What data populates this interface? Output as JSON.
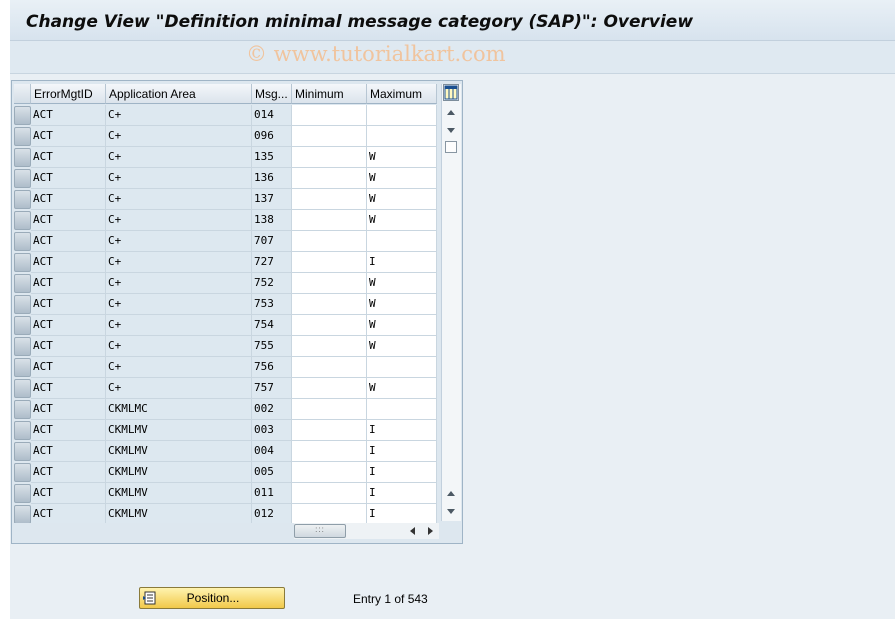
{
  "title": "Change View \"Definition minimal message category (SAP)\": Overview",
  "watermark": "© www.tutorialkart.com",
  "table": {
    "columns": [
      "ErrorMgtID",
      "Application Area",
      "Msg...",
      "Minimum",
      "Maximum"
    ],
    "rows": [
      [
        "ACT",
        "C+",
        "014",
        "",
        ""
      ],
      [
        "ACT",
        "C+",
        "096",
        "",
        ""
      ],
      [
        "ACT",
        "C+",
        "135",
        "",
        "W"
      ],
      [
        "ACT",
        "C+",
        "136",
        "",
        "W"
      ],
      [
        "ACT",
        "C+",
        "137",
        "",
        "W"
      ],
      [
        "ACT",
        "C+",
        "138",
        "",
        "W"
      ],
      [
        "ACT",
        "C+",
        "707",
        "",
        ""
      ],
      [
        "ACT",
        "C+",
        "727",
        "",
        "I"
      ],
      [
        "ACT",
        "C+",
        "752",
        "",
        "W"
      ],
      [
        "ACT",
        "C+",
        "753",
        "",
        "W"
      ],
      [
        "ACT",
        "C+",
        "754",
        "",
        "W"
      ],
      [
        "ACT",
        "C+",
        "755",
        "",
        "W"
      ],
      [
        "ACT",
        "C+",
        "756",
        "",
        ""
      ],
      [
        "ACT",
        "C+",
        "757",
        "",
        "W"
      ],
      [
        "ACT",
        "CKMLMC",
        "002",
        "",
        ""
      ],
      [
        "ACT",
        "CKMLMV",
        "003",
        "",
        "I"
      ],
      [
        "ACT",
        "CKMLMV",
        "004",
        "",
        "I"
      ],
      [
        "ACT",
        "CKMLMV",
        "005",
        "",
        "I"
      ],
      [
        "ACT",
        "CKMLMV",
        "011",
        "",
        "I"
      ],
      [
        "ACT",
        "CKMLMV",
        "012",
        "",
        "I"
      ]
    ]
  },
  "footer": {
    "position_button": "Position...",
    "entry_text": "Entry 1 of 543"
  }
}
